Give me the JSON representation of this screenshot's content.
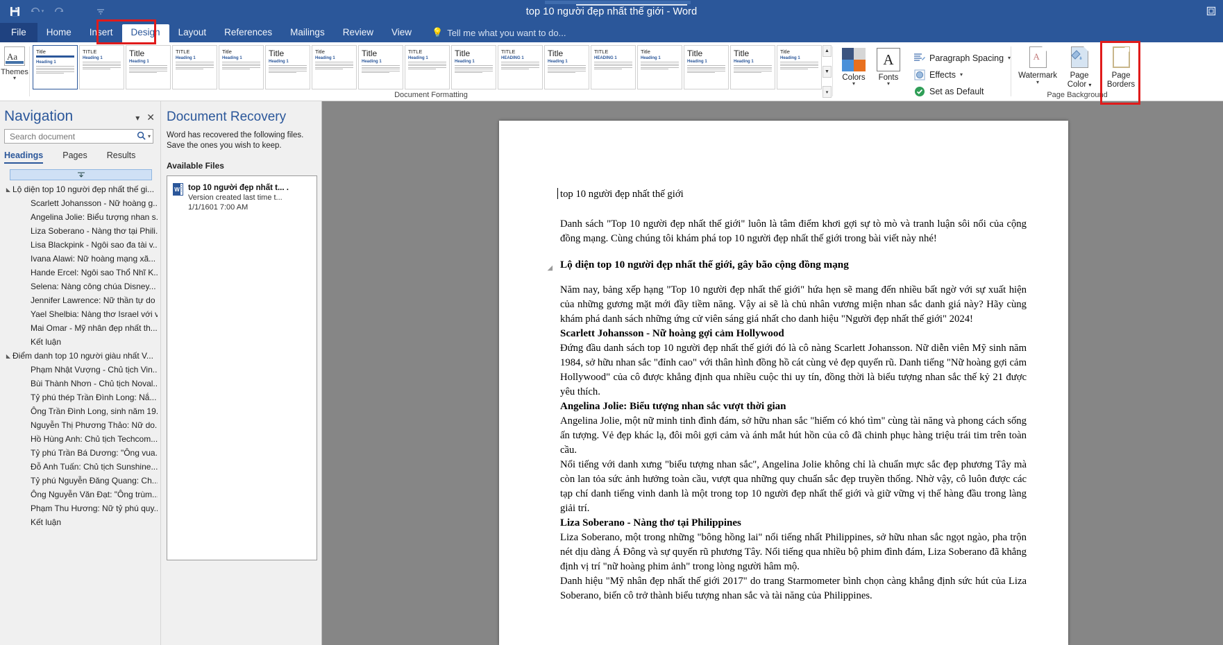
{
  "window": {
    "title": "top 10 người đẹp nhất thế giới - Word",
    "qat": [
      {
        "name": "save-button",
        "glyph": "💾"
      },
      {
        "name": "undo-button",
        "glyph": "↶"
      },
      {
        "name": "redo-button",
        "glyph": "↻"
      },
      {
        "name": "customize-qat-button",
        "glyph": "⌄"
      }
    ],
    "restore_glyph": "❐"
  },
  "tabs": [
    {
      "label": "File",
      "key": "file"
    },
    {
      "label": "Home",
      "key": "home"
    },
    {
      "label": "Insert",
      "key": "insert"
    },
    {
      "label": "Design",
      "key": "design"
    },
    {
      "label": "Layout",
      "key": "layout"
    },
    {
      "label": "References",
      "key": "references"
    },
    {
      "label": "Mailings",
      "key": "mailings"
    },
    {
      "label": "Review",
      "key": "review"
    },
    {
      "label": "View",
      "key": "view"
    }
  ],
  "tellme": {
    "text": "Tell me what you want to do...",
    "icon": "lightbulb-icon"
  },
  "ribbon": {
    "themes": {
      "label": "Themes",
      "glyph": "Aa"
    },
    "gallery_label": "Document Formatting",
    "styles": [
      {
        "title": "Title",
        "heading": "Heading 1",
        "variant": "plain"
      },
      {
        "title": "TITLE",
        "heading": "Heading 1",
        "variant": "caps"
      },
      {
        "title": "Title",
        "heading": "Heading 1",
        "variant": "lines"
      },
      {
        "title": "TITLE",
        "heading": "Heading 1",
        "variant": "lines"
      },
      {
        "title": "Title",
        "heading": "Heading 1",
        "variant": "lines"
      },
      {
        "title": "Title",
        "heading": "Heading 1",
        "variant": "lines"
      },
      {
        "title": "Title",
        "heading": "Heading 1",
        "variant": "lines"
      },
      {
        "title": "Title",
        "heading": "Heading 1",
        "variant": "lines"
      },
      {
        "title": "TITLE",
        "heading": "Heading 1",
        "variant": "lines"
      },
      {
        "title": "Title",
        "heading": "Heading 1",
        "variant": "lines"
      },
      {
        "title": "TITLE",
        "heading": "HEADING 1",
        "variant": "caps"
      },
      {
        "title": "Title",
        "heading": "Heading 1",
        "variant": "lines"
      },
      {
        "title": "TITLE",
        "heading": "HEADING 1",
        "variant": "lines"
      },
      {
        "title": "Title",
        "heading": "Heading 1",
        "variant": "lines"
      },
      {
        "title": "Title",
        "heading": "Heading 1",
        "variant": "lines"
      },
      {
        "title": "Title",
        "heading": "Heading 1",
        "variant": "lines"
      },
      {
        "title": "Title",
        "heading": "Heading 1",
        "variant": "lines"
      }
    ],
    "scroll": {
      "up": "▲",
      "down": "▼",
      "more": "≡"
    },
    "colors": {
      "label": "Colors",
      "swatch": [
        "#3b5480",
        "#d6d6d6",
        "#4a90d9",
        "#e8701f"
      ]
    },
    "fonts": {
      "label": "Fonts",
      "glyph": "A"
    },
    "paragraph_spacing": {
      "label": "Paragraph Spacing",
      "icon": "paragraph-spacing-icon"
    },
    "effects": {
      "label": "Effects",
      "icon": "effects-icon"
    },
    "set_as_default": {
      "label": "Set as Default",
      "icon": "check-circle-icon"
    },
    "page_background": {
      "label": "Page Background",
      "watermark": {
        "label": "Watermark",
        "icon": "watermark-icon"
      },
      "page_color": {
        "label": "Page\nColor",
        "icon": "page-color-icon"
      },
      "page_borders": {
        "label": "Page\nBorders",
        "icon": "page-borders-icon"
      }
    }
  },
  "navigation": {
    "title": "Navigation",
    "collapse_glyph": "▾",
    "close_glyph": "✕",
    "search_placeholder": "Search document",
    "search_value": "",
    "search_icon": "search-icon",
    "tabs": [
      {
        "label": "Headings",
        "active": true
      },
      {
        "label": "Pages",
        "active": false
      },
      {
        "label": "Results",
        "active": false
      }
    ],
    "items": [
      {
        "label": "Lộ diện top 10 người đẹp nhất thế gi...",
        "level": 1,
        "expandable": true
      },
      {
        "label": "Scarlett Johansson - Nữ hoàng g...",
        "level": 2,
        "expandable": false
      },
      {
        "label": "Angelina Jolie: Biểu tượng nhan s...",
        "level": 2,
        "expandable": false
      },
      {
        "label": "Liza Soberano - Nàng thơ tại Phili...",
        "level": 2,
        "expandable": false
      },
      {
        "label": "Lisa Blackpink - Ngôi sao đa tài v...",
        "level": 2,
        "expandable": false
      },
      {
        "label": "Ivana Alawi: Nữ hoàng mạng xã...",
        "level": 2,
        "expandable": false
      },
      {
        "label": "Hande Ercel: Ngôi sao Thổ Nhĩ K...",
        "level": 2,
        "expandable": false
      },
      {
        "label": "Selena: Nàng công chúa Disney...",
        "level": 2,
        "expandable": false
      },
      {
        "label": "Jennifer Lawrence: Nữ thần tự do",
        "level": 2,
        "expandable": false
      },
      {
        "label": "Yael Shelbia: Nàng thơ Israel với v...",
        "level": 2,
        "expandable": false
      },
      {
        "label": "Mai Omar - Mỹ nhân đẹp nhất th...",
        "level": 2,
        "expandable": false
      },
      {
        "label": "Kết luận",
        "level": 2,
        "expandable": false
      },
      {
        "label": "Điểm danh top 10 người giàu nhất V...",
        "level": 1,
        "expandable": true
      },
      {
        "label": "Phạm Nhật Vượng - Chủ tịch Vin...",
        "level": 2,
        "expandable": false
      },
      {
        "label": "Bùi Thành Nhơn - Chủ tịch Noval...",
        "level": 2,
        "expandable": false
      },
      {
        "label": "Tỷ phú thép Trần Đình Long: Nắ...",
        "level": 2,
        "expandable": false
      },
      {
        "label": "Ông Trần Đình Long, sinh năm 19...",
        "level": 2,
        "expandable": false
      },
      {
        "label": "Nguyễn Thị Phương Thảo: Nữ do...",
        "level": 2,
        "expandable": false
      },
      {
        "label": "Hồ Hùng Anh: Chủ tịch Techcom...",
        "level": 2,
        "expandable": false
      },
      {
        "label": "Tỷ phú Trần Bá Dương: \"Ông vua...",
        "level": 2,
        "expandable": false
      },
      {
        "label": "Đỗ Anh Tuấn: Chủ tịch Sunshine...",
        "level": 2,
        "expandable": false
      },
      {
        "label": "Tỷ phú Nguyễn Đăng Quang: Ch...",
        "level": 2,
        "expandable": false
      },
      {
        "label": "Ông Nguyễn Văn Đạt: \"Ông trùm...",
        "level": 2,
        "expandable": false
      },
      {
        "label": "Phạm Thu Hương: Nữ tỷ phú quy...",
        "level": 2,
        "expandable": false
      },
      {
        "label": "Kết luận",
        "level": 2,
        "expandable": false
      }
    ]
  },
  "recovery": {
    "title": "Document Recovery",
    "description": "Word has recovered the following files. Save the ones you wish to keep.",
    "available_label": "Available Files",
    "files": [
      {
        "name": "top 10 người đẹp nhất t... .",
        "sub": "Version created last time t...",
        "timestamp": "1/1/1601 7:00 AM",
        "icon": "word-file-icon"
      }
    ]
  },
  "document": {
    "title_line": "top 10 người đẹp nhất thế giới",
    "intro": "Danh sách \"Top 10 người đẹp nhất thế giới\" luôn là tâm điểm khơi gợi sự tò mò và tranh luận sôi nổi của cộng đồng mạng. Cùng chúng tôi khám phá top 10 người đẹp nhất thế giới trong bài viết này nhé!",
    "heading1": "Lộ diện top 10 người đẹp nhất thế giới, gây bão cộng đồng mạng",
    "para1": "Năm nay, bảng xếp hạng \"Top 10 người đẹp nhất thế giới\" hứa hẹn sẽ mang đến nhiều bất ngờ với sự xuất hiện của những gương mặt mới đầy tiềm năng. Vậy ai sẽ là chủ nhân vương miện nhan sắc danh giá này? Hãy cùng khám phá danh sách những ứng cử viên sáng giá nhất cho danh hiệu \"Người đẹp nhất thế giới\" 2024!",
    "h2_scarlett": "Scarlett Johansson - Nữ hoàng gợi cảm Hollywood",
    "p_scarlett": "Đứng đầu danh sách top 10 người đẹp nhất thế giới đó là cô nàng Scarlett Johansson. Nữ diễn viên Mỹ sinh năm 1984, sở hữu nhan sắc \"đỉnh cao\" với thân hình đồng hồ cát cùng vẻ đẹp quyến rũ. Danh tiếng \"Nữ hoàng gợi cảm Hollywood\" của cô được khẳng định qua nhiều cuộc thi uy tín, đồng thời là biểu tượng nhan sắc thế kỷ 21 được yêu thích.",
    "h2_angelina": "Angelina Jolie: Biểu tượng nhan sắc vượt thời gian",
    "p_angelina_1": "Angelina Jolie, một nữ minh tinh đình đám, sở hữu nhan sắc \"hiếm có khó tìm\" cùng tài năng và phong cách sống ấn tượng. Vẻ đẹp khác lạ, đôi môi gợi cảm và ánh mắt hút hồn của cô đã chinh phục hàng triệu trái tim trên toàn cầu.",
    "p_angelina_2": "Nổi tiếng với danh xưng \"biểu tượng nhan sắc\", Angelina Jolie không chỉ là chuẩn mực sắc đẹp phương Tây mà còn lan tỏa sức ảnh hưởng toàn cầu, vượt qua những quy chuẩn sắc đẹp truyền thống. Nhờ vậy, cô luôn được các tạp chí danh tiếng vinh danh là một trong top 10 người đẹp nhất thế giới và giữ vững vị thế hàng đầu trong làng giải trí.",
    "h2_liza": "Liza Soberano - Nàng thơ tại Philippines",
    "p_liza_1": "Liza Soberano, một trong những \"bông hồng lai\" nổi tiếng nhất Philippines, sở hữu nhan sắc ngọt ngào, pha trộn nét dịu dàng Á Đông và sự quyến rũ phương Tây. Nổi tiếng qua nhiều bộ phim đình đám, Liza Soberano đã khẳng định vị trí \"nữ hoàng phim ảnh\" trong lòng người hâm mộ.",
    "p_liza_2": "Danh hiệu \"Mỹ nhân đẹp nhất thế giới 2017\" do trang Starmometer bình chọn càng khẳng định sức hút của Liza Soberano, biến cô trở thành biểu tượng nhan sắc và tài năng của Philippines."
  },
  "colors": {
    "accent": "#2b579a",
    "highlight": "#e01b1b",
    "canvas": "#868686",
    "pane": "#f0f0f0"
  }
}
